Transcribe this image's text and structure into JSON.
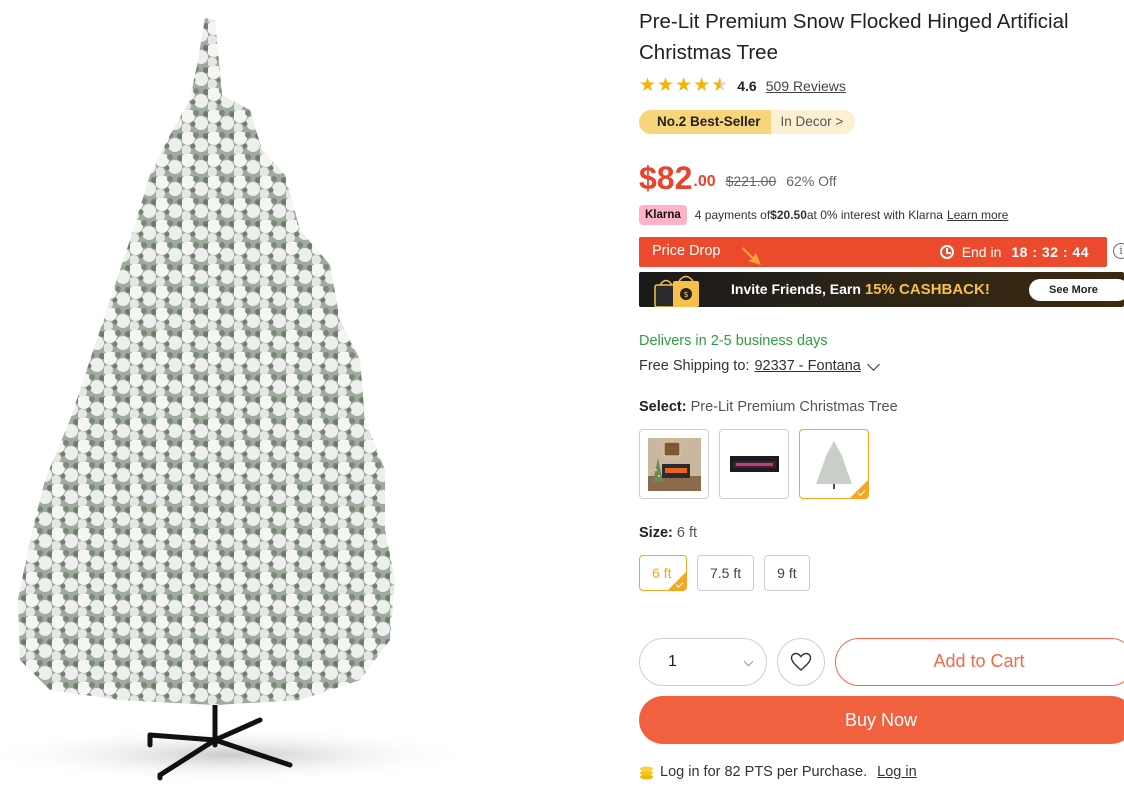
{
  "product": {
    "title": "Pre-Lit Premium Snow Flocked Hinged Artificial Christmas Tree",
    "image_alt": "snow-flocked-christmas-tree"
  },
  "rating": {
    "value": "4.6",
    "stars": 4.6,
    "reviews_label": "509 Reviews"
  },
  "badge": {
    "rank": "No.2 Best-Seller",
    "category": "In Decor >"
  },
  "price": {
    "currency_main": "$82",
    "cents": ".00",
    "original": "$221.00",
    "discount": "62% Off"
  },
  "klarna": {
    "logo": "Klarna",
    "prefix": "4 payments of ",
    "amount": "$20.50",
    "suffix": " at 0% interest with Klarna",
    "learn_more": "Learn more"
  },
  "price_drop": {
    "label": "Price Drop",
    "ends_label": "End in",
    "time": "18 : 32 : 44"
  },
  "cashback": {
    "prefix": "Invite Friends, Earn ",
    "highlight": "15% CASHBACK!",
    "button": "See More"
  },
  "delivery": {
    "estimate": "Delivers in 2-5 business days",
    "shipping_prefix": "Free Shipping to:",
    "location": "92337 - Fontana"
  },
  "select": {
    "label": "Select:",
    "value": "Pre-Lit Premium Christmas Tree"
  },
  "size": {
    "label": "Size:",
    "value": "6 ft",
    "options": [
      "6 ft",
      "7.5 ft",
      "9 ft"
    ]
  },
  "actions": {
    "quantity": "1",
    "add_to_cart": "Add to Cart",
    "buy_now": "Buy Now"
  },
  "points": {
    "text": "Log in for 82 PTS per Purchase.",
    "login": "Log in"
  },
  "colors": {
    "accent": "#f2613f",
    "price": "#e8432d",
    "selected_border": "#f5a623",
    "delivery_green": "#2f9e3f"
  }
}
